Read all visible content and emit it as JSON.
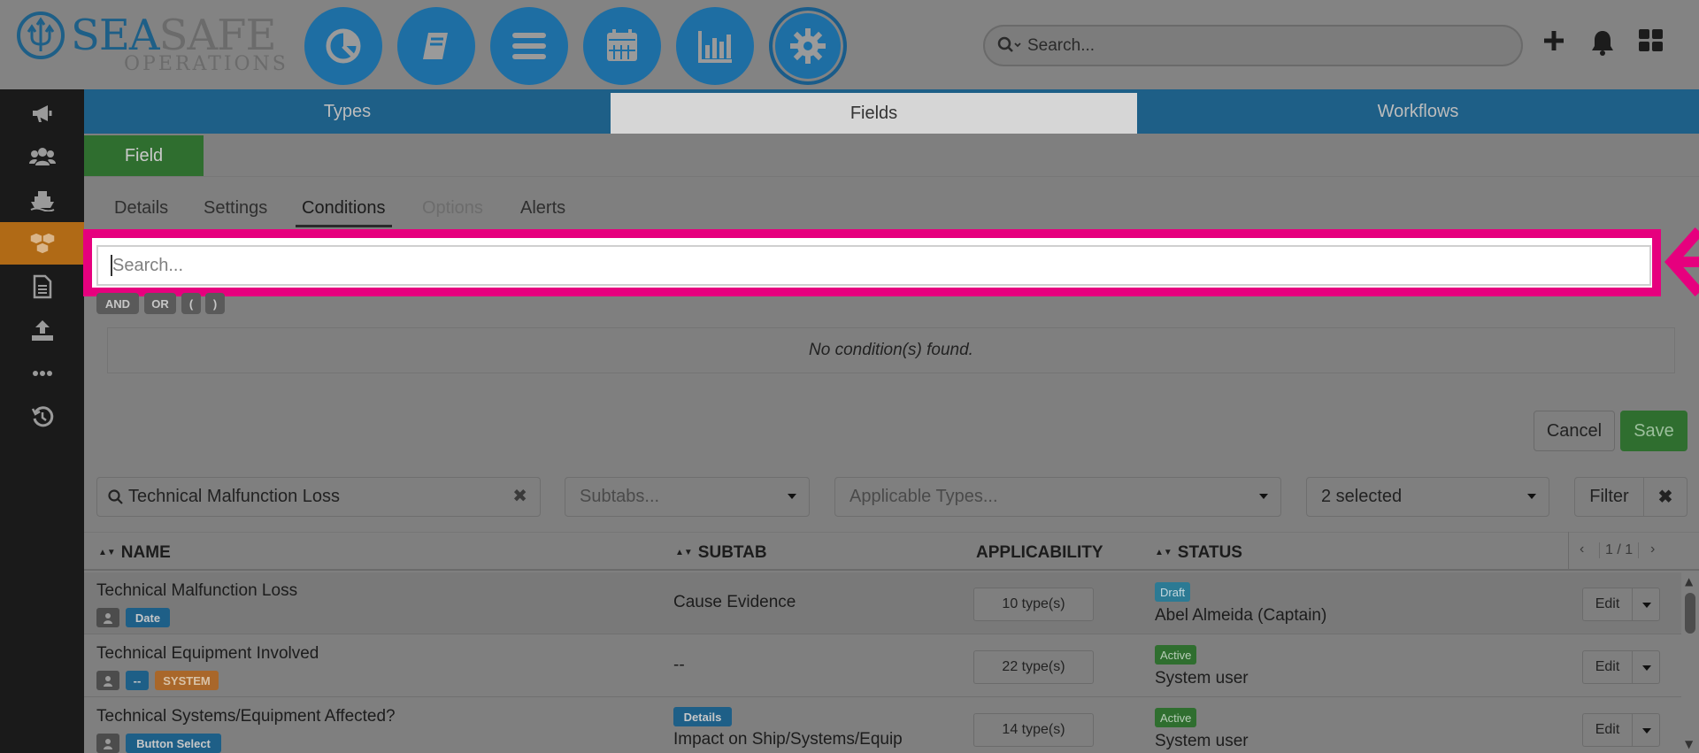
{
  "brand": {
    "name_part1": "SEA",
    "name_part2": "SAFE",
    "subtitle": "OPERATIONS"
  },
  "top_nav": {
    "icons": [
      "dashboard-pie-icon",
      "book-icon",
      "list-menu-icon",
      "calendar-icon",
      "bar-chart-icon",
      "gear-icon"
    ],
    "search_placeholder": "Search..."
  },
  "header_actions": [
    "plus-icon",
    "bell-icon",
    "grid-apps-icon"
  ],
  "sidebar": {
    "items": [
      "megaphone-icon",
      "users-icon",
      "ship-icon",
      "boxes-icon",
      "document-icon",
      "upload-icon",
      "more-icon",
      "history-icon"
    ],
    "active_index": 3
  },
  "tabs": [
    {
      "label": "Types"
    },
    {
      "label": "Fields"
    },
    {
      "label": "Workflows"
    }
  ],
  "active_tab": "Fields",
  "field_button": "Field",
  "subtabs": [
    {
      "label": "Details"
    },
    {
      "label": "Settings"
    },
    {
      "label": "Conditions"
    },
    {
      "label": "Options"
    },
    {
      "label": "Alerts"
    }
  ],
  "conditions": {
    "search_placeholder": "Search...",
    "operators": [
      "AND",
      "OR",
      "(",
      ")"
    ],
    "empty_message": "No condition(s) found."
  },
  "actions": {
    "cancel": "Cancel",
    "save": "Save"
  },
  "filters": {
    "search_value": "Technical Malfunction Loss",
    "subtabs_placeholder": "Subtabs...",
    "types_placeholder": "Applicable Types...",
    "status_value": "2 selected",
    "filter_label": "Filter"
  },
  "table": {
    "columns": {
      "name": "NAME",
      "subtab": "SUBTAB",
      "applicability": "APPLICABILITY",
      "status": "STATUS"
    },
    "pager": "1 / 1",
    "rows": [
      {
        "name": "Technical Malfunction Loss",
        "tags": [
          "Date"
        ],
        "subtab_badge": "",
        "subtab": "Cause Evidence",
        "applicability": "10 type(s)",
        "status": "Draft",
        "user": "Abel Almeida (Captain)",
        "edit": "Edit"
      },
      {
        "name": "Technical Equipment Involved",
        "tags": [
          "--",
          "SYSTEM"
        ],
        "subtab_badge": "",
        "subtab": "--",
        "applicability": "22 type(s)",
        "status": "Active",
        "user": "System user",
        "edit": "Edit"
      },
      {
        "name": "Technical Systems/Equipment Affected?",
        "tags": [
          "Button Select"
        ],
        "subtab_badge": "Details",
        "subtab": "Impact on Ship/Systems/Equip",
        "applicability": "14 type(s)",
        "status": "Active",
        "user": "System user",
        "edit": "Edit"
      }
    ]
  },
  "colors": {
    "brand_blue": "#1e6ea3",
    "highlight": "#e6007e",
    "save_green": "#2f6e2f",
    "sidebar_active": "#b06a16"
  }
}
